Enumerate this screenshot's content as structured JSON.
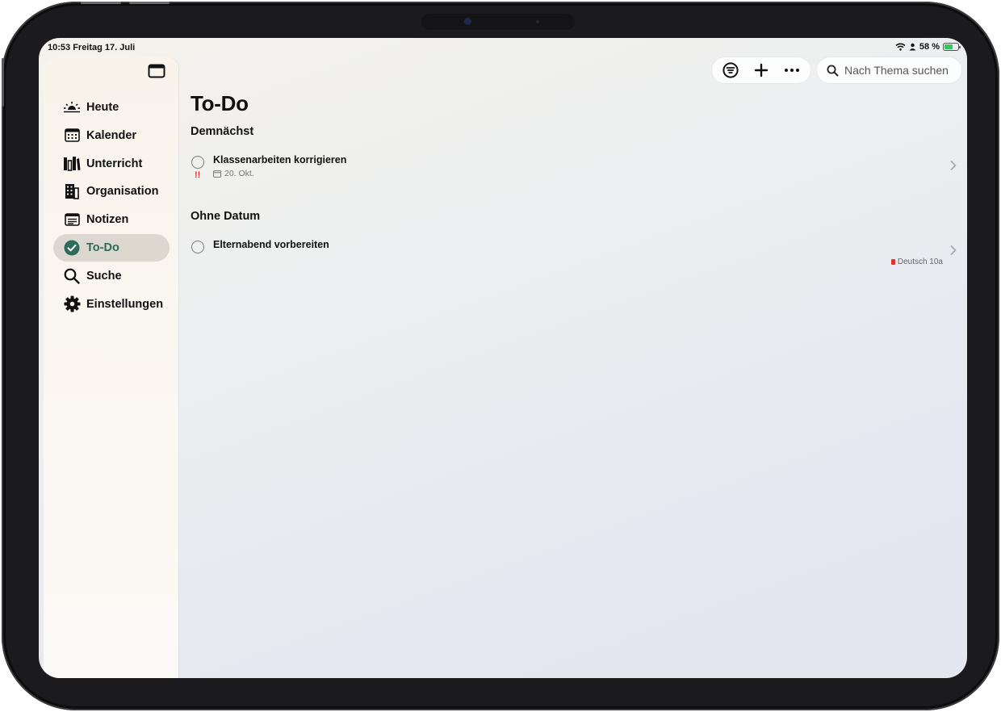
{
  "status_bar": {
    "time_date": "10:53  Freitag 17. Juli",
    "battery": "58 %",
    "battery_level": 0.58
  },
  "sidebar": {
    "items": [
      {
        "label": "Heute",
        "icon": "sunrise-icon"
      },
      {
        "label": "Kalender",
        "icon": "calendar-icon"
      },
      {
        "label": "Unterricht",
        "icon": "books-icon"
      },
      {
        "label": "Organisation",
        "icon": "building-icon"
      },
      {
        "label": "Notizen",
        "icon": "notes-icon"
      },
      {
        "label": "To-Do",
        "icon": "checkmark-circle-icon",
        "active": true
      },
      {
        "label": "Suche",
        "icon": "search-icon"
      },
      {
        "label": "Einstellungen",
        "icon": "gear-icon"
      }
    ],
    "accent_color": "#2d6c5a"
  },
  "toolbar": {
    "search_placeholder": "Nach Thema suchen"
  },
  "main": {
    "title": "To-Do",
    "sections": [
      {
        "title": "Demnächst",
        "items": [
          {
            "title": "Klassenarbeiten korrigieren",
            "date": "20. Okt.",
            "priority": "!!",
            "tag": ""
          }
        ]
      },
      {
        "title": "Ohne Datum",
        "items": [
          {
            "title": "Elternabend vorbereiten",
            "date": "",
            "priority": "",
            "tag": "Deutsch 10a",
            "tag_color": "#e0332e"
          }
        ]
      }
    ]
  }
}
